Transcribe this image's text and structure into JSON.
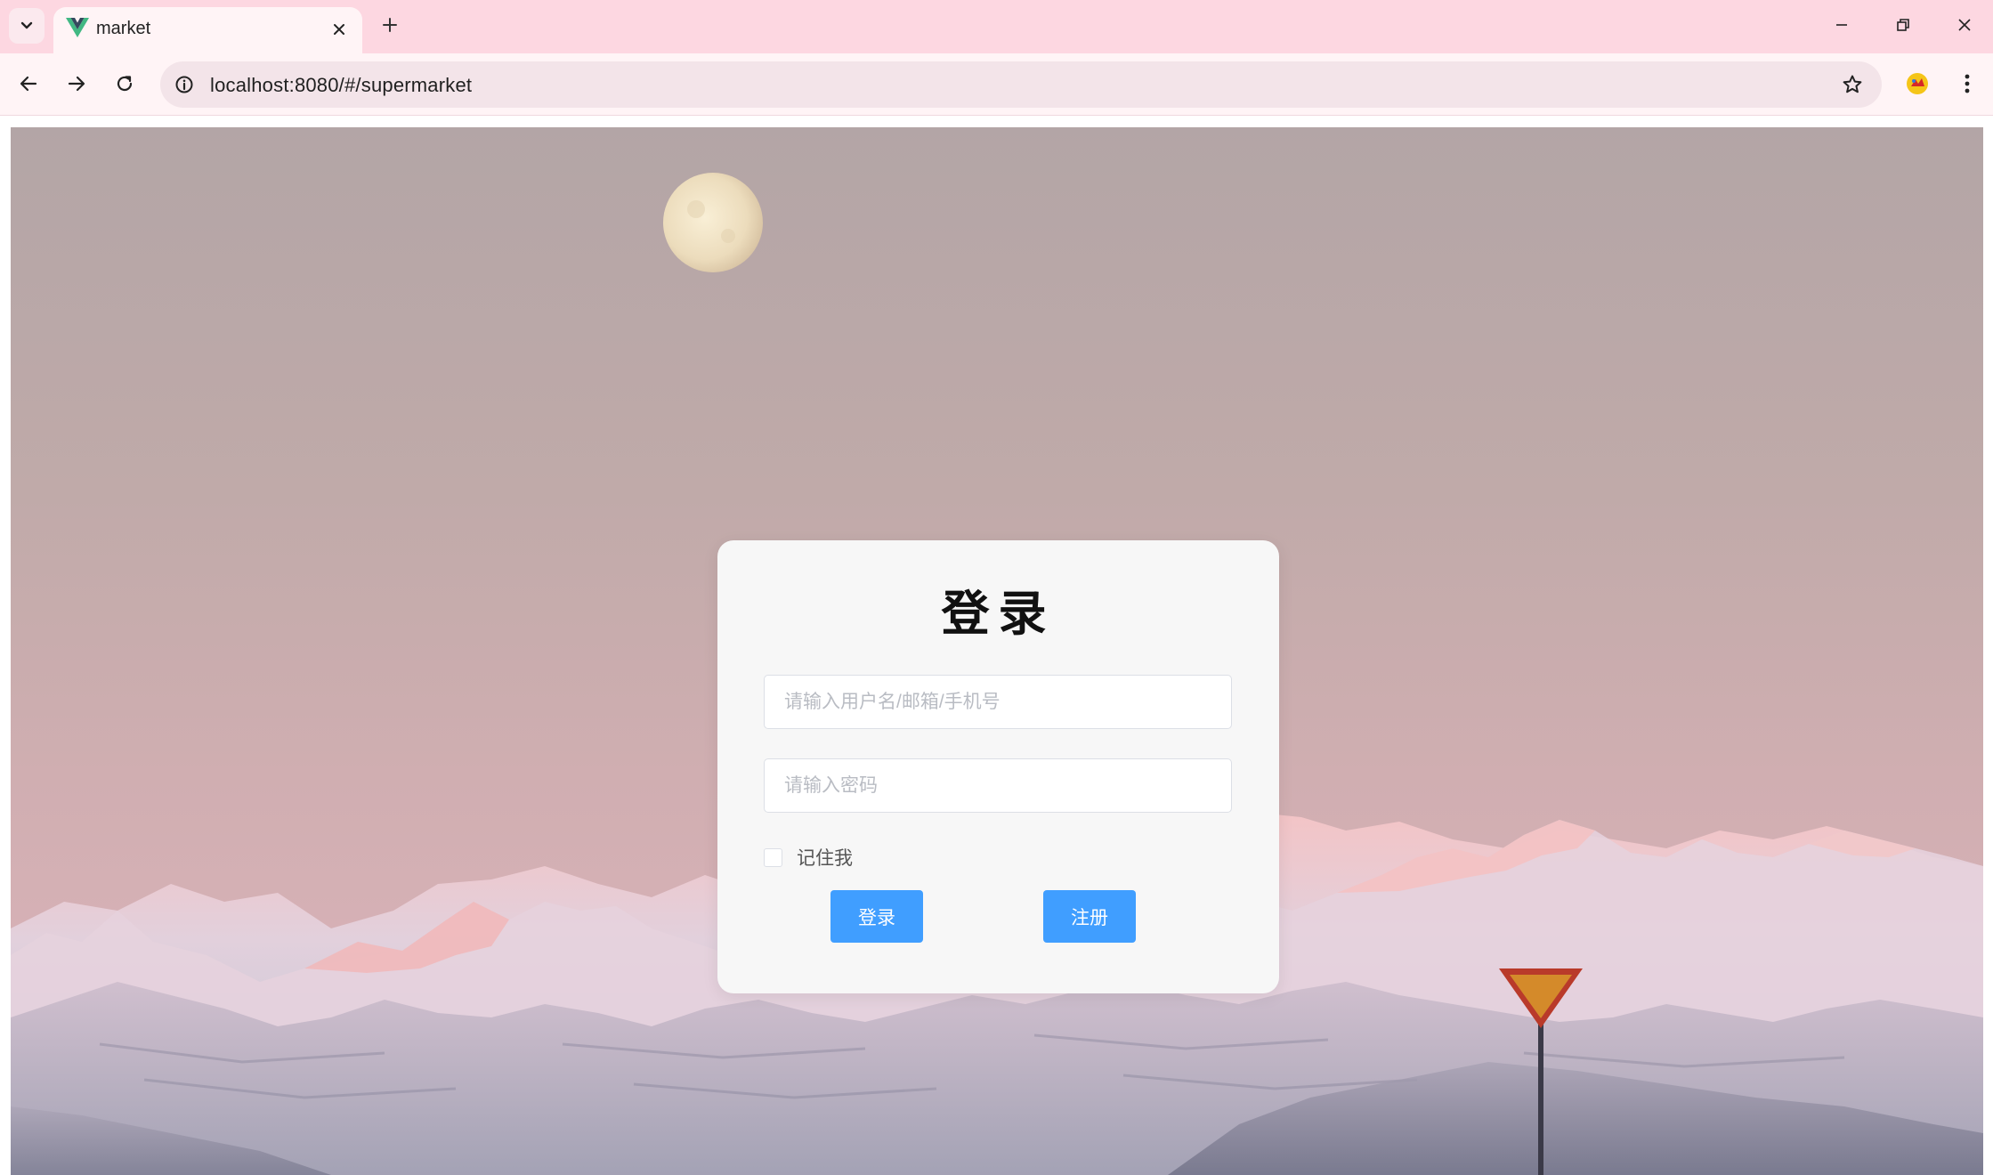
{
  "browser": {
    "tab_title": "market",
    "url": "localhost:8080/#/supermarket",
    "icons": [
      "tab-search-icon",
      "vue-logo-icon",
      "close-icon",
      "plus-icon",
      "minimize-icon",
      "restore-icon",
      "window-close-icon",
      "back-arrow-icon",
      "forward-arrow-icon",
      "reload-icon",
      "site-info-icon",
      "bookmark-star-icon",
      "extension-icon",
      "more-menu-icon"
    ]
  },
  "login": {
    "title": "登录",
    "username_placeholder": "请输入用户名/邮箱/手机号",
    "password_placeholder": "请输入密码",
    "remember_label": "记住我",
    "login_button": "登录",
    "register_button": "注册"
  },
  "colors": {
    "tabbar": "#fdd7e1",
    "toolbar": "#fff4f6",
    "card": "#f7f7f7",
    "primary_button": "#409eff"
  }
}
